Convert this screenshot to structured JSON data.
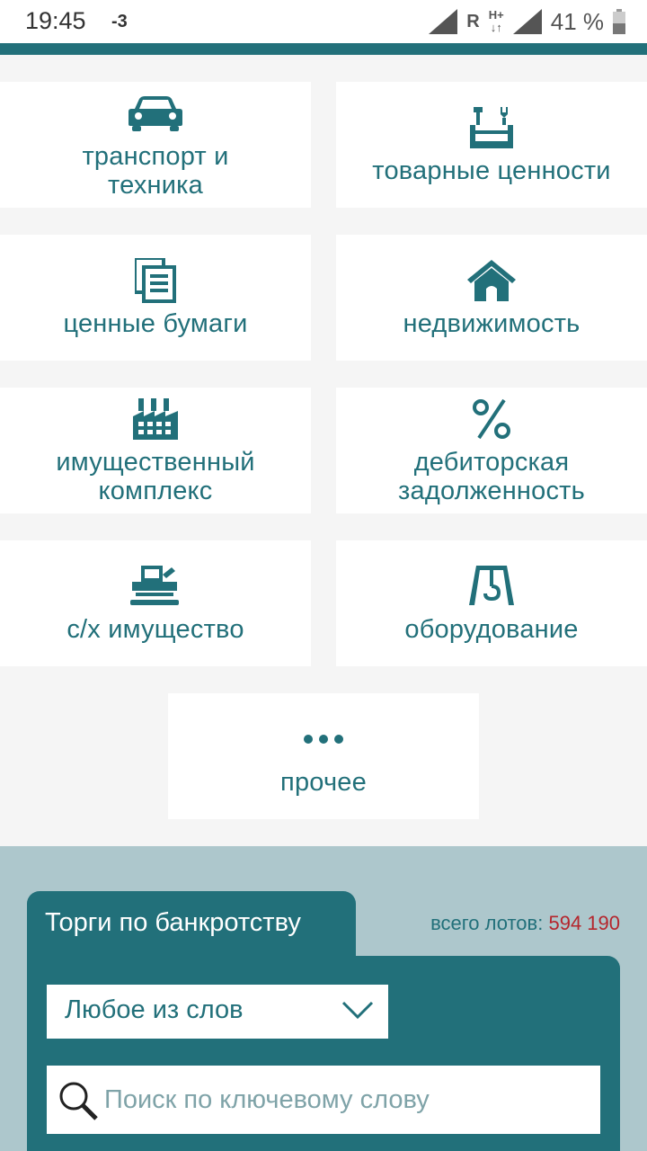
{
  "status_bar": {
    "time": "19:45",
    "indicator": "-3",
    "roaming": "R",
    "network": "H+",
    "battery": "41 %"
  },
  "categories": [
    {
      "label": "транспорт и\nтехника",
      "icon": "car-icon"
    },
    {
      "label": "товарные ценности",
      "icon": "toolbox-icon"
    },
    {
      "label": "ценные бумаги",
      "icon": "documents-icon"
    },
    {
      "label": "недвижимость",
      "icon": "house-icon"
    },
    {
      "label": "имущественный\nкомплекс",
      "icon": "factory-icon"
    },
    {
      "label": "дебиторская\nзадолженность",
      "icon": "percent-icon"
    },
    {
      "label": "с/х имущество",
      "icon": "harvester-icon"
    },
    {
      "label": "оборудование",
      "icon": "crane-hook-icon"
    },
    {
      "label": "прочее",
      "icon": "more-dots-icon"
    }
  ],
  "search": {
    "tab_label": "Торги по банкротству",
    "lots_label": "всего лотов:",
    "lots_count": "594 190",
    "mode_selected": "Любое из слов",
    "placeholder": "Поиск по ключевому слову"
  },
  "colors": {
    "accent": "#22707a",
    "count_red": "#b5262d",
    "search_bg": "#adc7cc"
  }
}
